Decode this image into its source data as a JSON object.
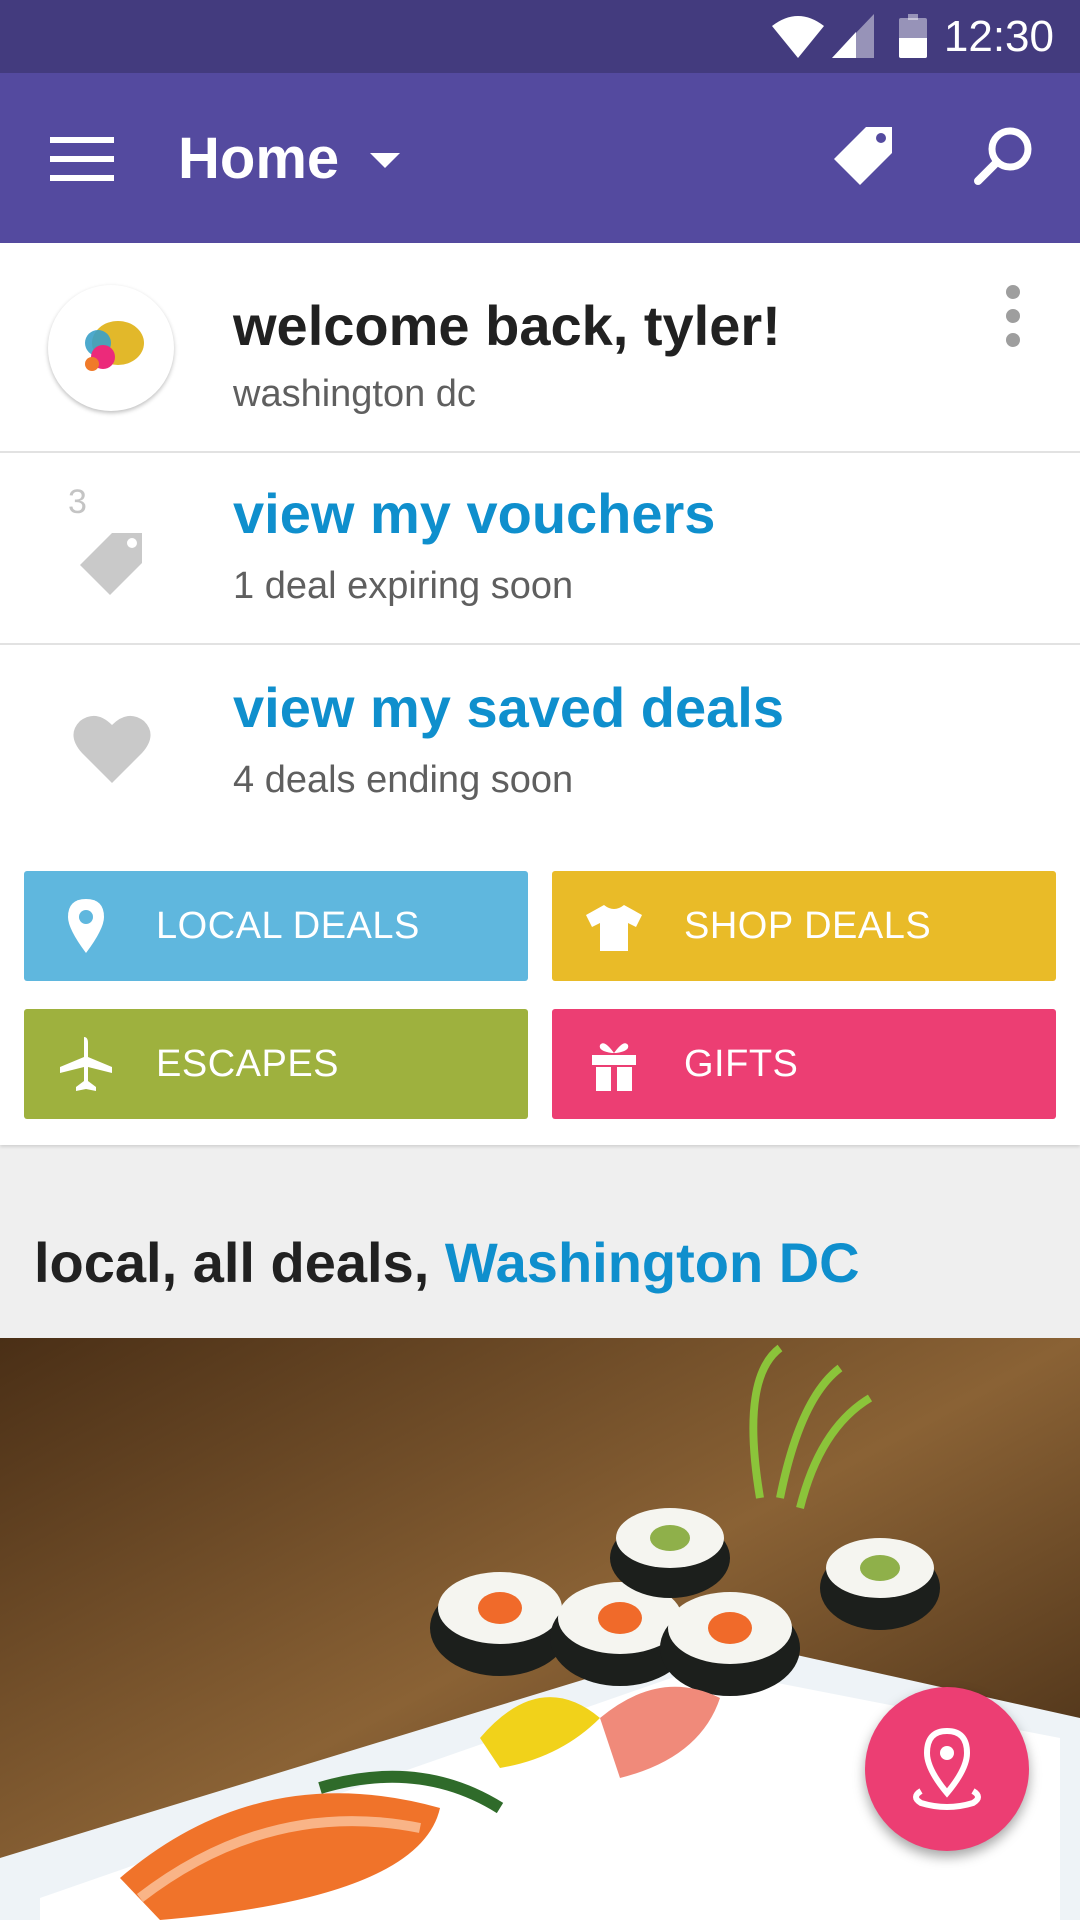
{
  "status_bar": {
    "time": "12:30"
  },
  "app_bar": {
    "title": "Home",
    "icons": [
      "menu-icon",
      "chevron-down-icon",
      "tag-icon",
      "search-icon"
    ]
  },
  "welcome": {
    "title": "welcome back, tyler!",
    "location": "washington dc"
  },
  "vouchers": {
    "count": "3",
    "title": "view my vouchers",
    "subtitle": "1 deal expiring soon"
  },
  "saved": {
    "title": "view my saved deals",
    "subtitle": "4 deals ending soon"
  },
  "categories": [
    {
      "label": "LOCAL DEALS",
      "icon": "map-pin-icon",
      "color": "#5fb7de"
    },
    {
      "label": "SHOP DEALS",
      "icon": "shirt-icon",
      "color": "#e9bb28"
    },
    {
      "label": "ESCAPES",
      "icon": "airplane-icon",
      "color": "#9eb13e"
    },
    {
      "label": "GIFTS",
      "icon": "gift-icon",
      "color": "#ec3e73"
    }
  ],
  "section": {
    "prefix": "local, all deals, ",
    "location": "Washington DC"
  },
  "colors": {
    "app_bar": "#544a9f",
    "status_bar": "#433b7e",
    "link": "#0f8fcd",
    "fab": "#ec3e73"
  }
}
